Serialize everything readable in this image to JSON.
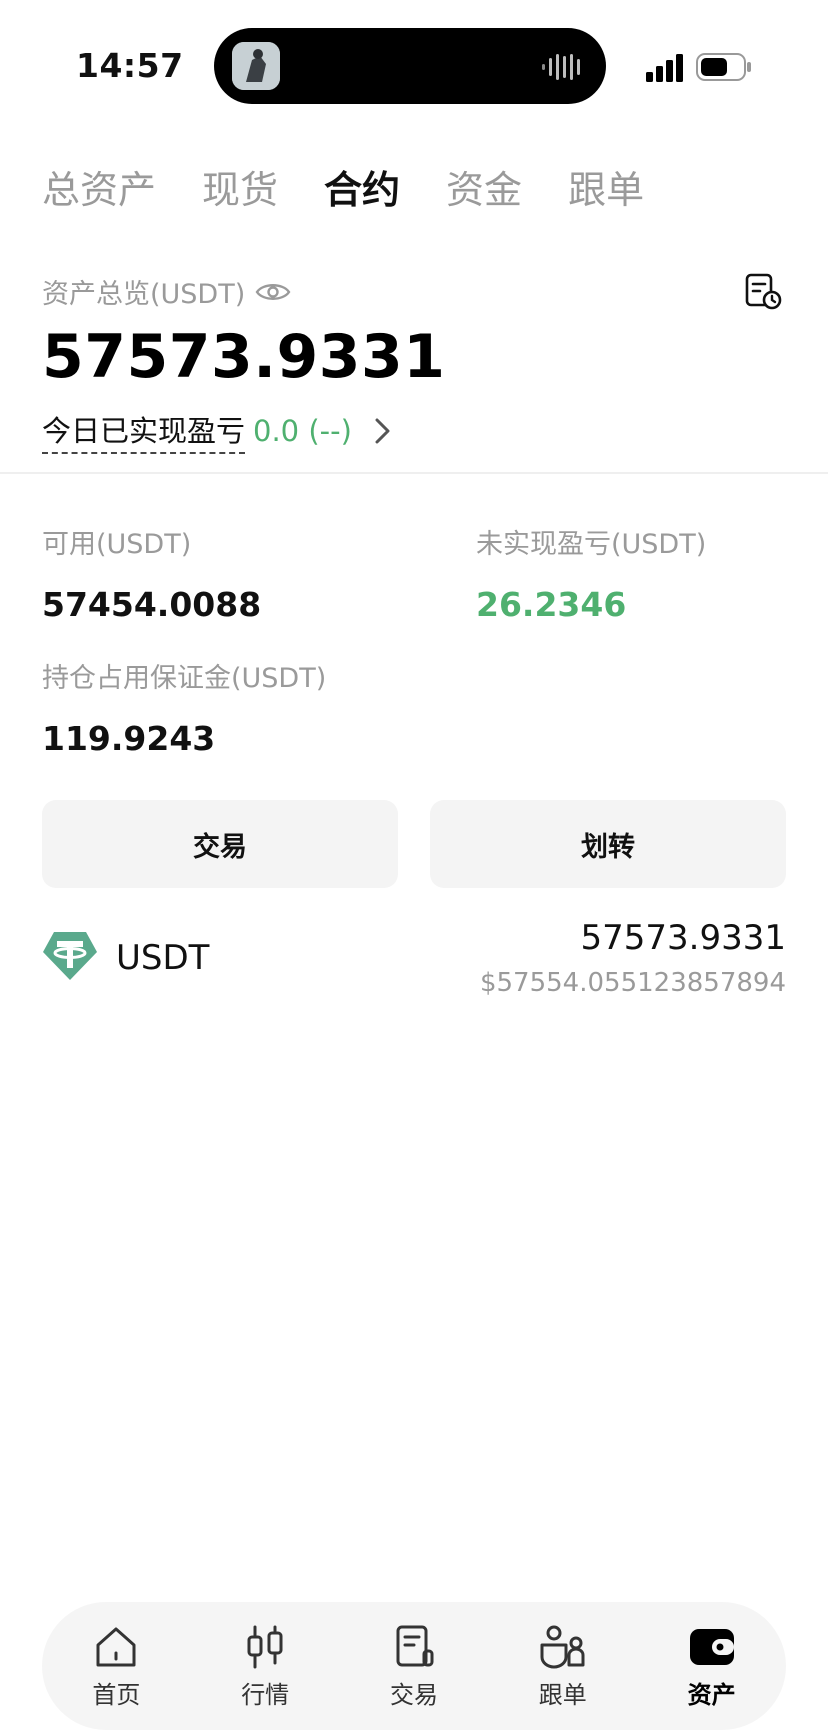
{
  "status_bar": {
    "time": "14:57"
  },
  "tabs": [
    {
      "label": "总资产",
      "active": false
    },
    {
      "label": "现货",
      "active": false
    },
    {
      "label": "合约",
      "active": true
    },
    {
      "label": "资金",
      "active": false
    },
    {
      "label": "跟单",
      "active": false
    }
  ],
  "overview": {
    "label": "资产总览(USDT)",
    "total": "57573.9331",
    "pnl_label": "今日已实现盈亏",
    "pnl_value": "0.0 (--)"
  },
  "details": {
    "available_label": "可用(USDT)",
    "available_value": "57454.0088",
    "unrealized_label": "未实现盈亏(USDT)",
    "unrealized_value": "26.2346",
    "margin_label": "持仓占用保证金(USDT)",
    "margin_value": "119.9243"
  },
  "buttons": {
    "trade": "交易",
    "transfer": "划转"
  },
  "coin": {
    "name": "USDT",
    "amount": "57573.9331",
    "usd_value": "$57554.055123857894"
  },
  "nav": [
    {
      "label": "首页",
      "icon": "home-icon"
    },
    {
      "label": "行情",
      "icon": "candlestick-icon"
    },
    {
      "label": "交易",
      "icon": "document-icon"
    },
    {
      "label": "跟单",
      "icon": "users-icon"
    },
    {
      "label": "资产",
      "icon": "wallet-icon"
    }
  ],
  "colors": {
    "green": "#4fb06f",
    "muted": "#9a9a9a",
    "tether": "#5aa98c"
  }
}
